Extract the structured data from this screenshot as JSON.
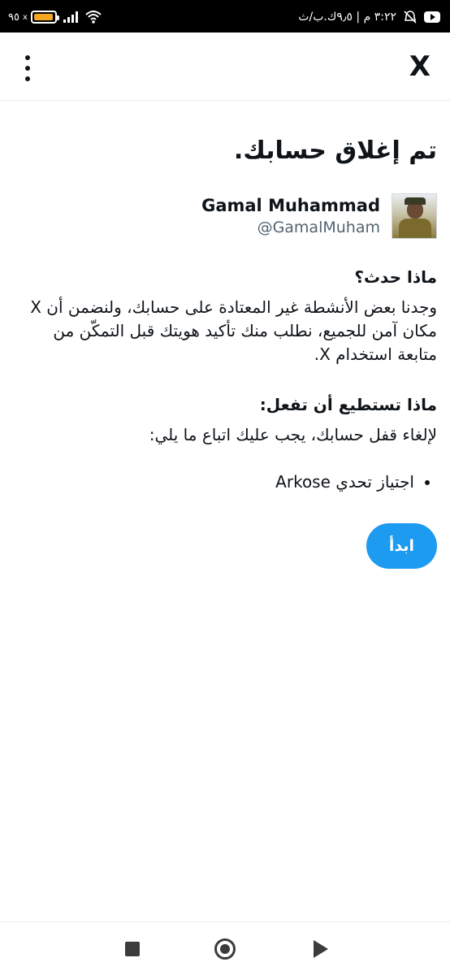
{
  "status_bar": {
    "battery_percent": "٩٥",
    "battery_level": 0.95,
    "battery_color": "#f5a623",
    "time": "٣:٢٢ م | ٩٫٥ك.ب/ث",
    "icons": [
      "battery-icon",
      "signal-icon",
      "wifi-icon",
      "youtube-icon",
      "notifications-muted-icon"
    ]
  },
  "app_bar": {
    "close_label": "X",
    "menu_icon": "more-vertical-icon"
  },
  "page": {
    "title": "تم إغلاق حسابك."
  },
  "account": {
    "display_name": "Gamal Muhammad",
    "handle": "@GamalMuham"
  },
  "what_happened": {
    "title": "ماذا حدث؟",
    "body": "وجدنا بعض الأنشطة غير المعتادة على حسابك، ولنضمن أن X مكان آمن للجميع، نطلب منك تأكيد هويتك قبل التمكّن من متابعة استخدام X."
  },
  "what_to_do": {
    "title": "ماذا تستطيع أن تفعل:",
    "body": "لإلغاء قفل حسابك، يجب عليك اتباع ما يلي:",
    "steps": [
      "اجتياز تحدي Arkose"
    ]
  },
  "actions": {
    "start_label": "ابدأ",
    "accent_color": "#1d9bf0"
  },
  "nav_bar": {
    "icons": [
      "recents-square-icon",
      "home-circle-icon",
      "back-triangle-icon"
    ]
  }
}
